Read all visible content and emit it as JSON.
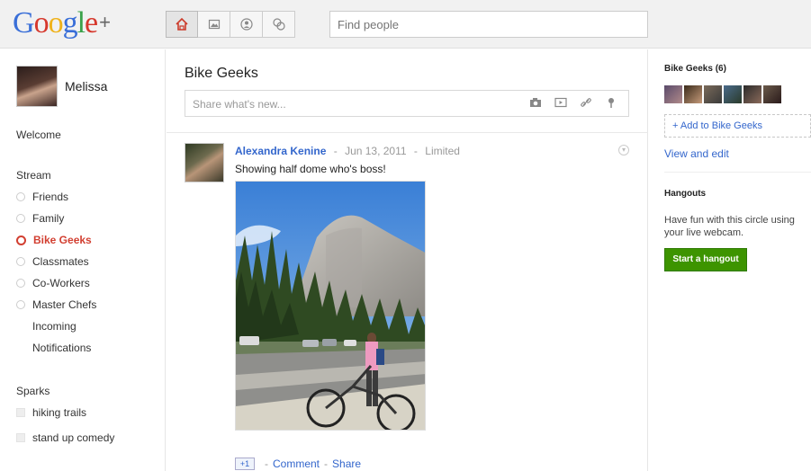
{
  "header": {
    "logo_text": "Google+",
    "nav_buttons": [
      {
        "icon": "home-icon",
        "active": true
      },
      {
        "icon": "photos-icon",
        "active": false
      },
      {
        "icon": "profile-icon",
        "active": false
      },
      {
        "icon": "circles-icon",
        "active": false
      }
    ],
    "search": {
      "placeholder": "Find people"
    }
  },
  "left": {
    "profile_name": "Melissa",
    "welcome": "Welcome",
    "stream_title": "Stream",
    "stream_items": [
      {
        "label": "Friends",
        "active": false
      },
      {
        "label": "Family",
        "active": false
      },
      {
        "label": "Bike Geeks",
        "active": true
      },
      {
        "label": "Classmates",
        "active": false
      },
      {
        "label": "Co-Workers",
        "active": false
      },
      {
        "label": "Master Chefs",
        "active": false
      }
    ],
    "extra_items": [
      "Incoming",
      "Notifications"
    ],
    "sparks_title": "Sparks",
    "sparks": [
      "hiking trails",
      "stand up comedy"
    ]
  },
  "main": {
    "circle_title": "Bike Geeks",
    "share_placeholder": "Share what's new...",
    "share_icons": [
      "camera-icon",
      "video-icon",
      "link-icon",
      "location-icon"
    ],
    "post": {
      "author": "Alexandra Kenine",
      "date": "Jun 13, 2011",
      "visibility": "Limited",
      "text": "Showing half dome who's boss!",
      "plus_one": "+1",
      "comment": "Comment",
      "share": "Share",
      "separator": "-"
    }
  },
  "right": {
    "circle_header": "Bike Geeks (6)",
    "add_circle": "+ Add to Bike Geeks",
    "view_edit": "View and edit",
    "hangouts_title": "Hangouts",
    "hangouts_text": "Have fun with this circle using your live webcam.",
    "hangout_button": "Start a hangout",
    "member_count": 6
  },
  "colors": {
    "link": "#3366cc",
    "active": "#d23f31",
    "hangout_green": "#3d9400"
  }
}
